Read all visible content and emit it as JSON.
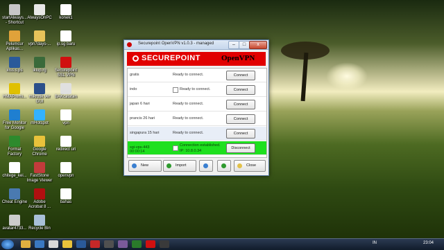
{
  "desktop": {
    "icons": [
      {
        "label": "startAlways... - Shortcut",
        "color": "#c7c7c7"
      },
      {
        "label": "AlwaysOnPC",
        "color": "#e8e8e8"
      },
      {
        "label": "konek1",
        "color": "#ffffff"
      },
      {
        "label": "Pelumcur Aplikas...",
        "color": "#e0a23a"
      },
      {
        "label": "vpn7days-...",
        "color": "#e6c35a"
      },
      {
        "label": "ip.sg baru",
        "color": "#ffffff"
      },
      {
        "label": "kiss.s.ps",
        "color": "#2a5a9a"
      },
      {
        "label": "ikiup.rg",
        "color": "#3a6a3a"
      },
      {
        "label": "Securepoint SSL VPN",
        "color": "#d01010"
      },
      {
        "label": "HMAPremi...",
        "color": "#e0c000"
      },
      {
        "label": "mikrotik ver GUI",
        "color": "#2b4f8a"
      },
      {
        "label": "BAKcatatan",
        "color": "#e0e0e0"
      },
      {
        "label": "Free Monitor for Google",
        "color": "#1f7fd0"
      },
      {
        "label": "mHotspot",
        "color": "#33b2ff"
      },
      {
        "label": "vpn",
        "color": "#ffffff"
      },
      {
        "label": "Format Factory",
        "color": "#2d8a2d"
      },
      {
        "label": "Google Chrome",
        "color": "#e9c23b"
      },
      {
        "label": "redirect uri",
        "color": "#ffffff"
      },
      {
        "label": "chitege_kei...",
        "color": "#ffffff"
      },
      {
        "label": "FastStone Image Viewer",
        "color": "#c23b3b"
      },
      {
        "label": "openvpn",
        "color": "#ffffff"
      },
      {
        "label": "Cheat Engine",
        "color": "#4a7ab0"
      },
      {
        "label": "Adobe Acrobat 8 ...",
        "color": "#b01010"
      },
      {
        "label": "bahas",
        "color": "#ffffff"
      },
      {
        "label": "avatar4733...",
        "color": "#cccccc"
      },
      {
        "label": "Recycle Bin",
        "color": "#a8c0d8"
      }
    ]
  },
  "window": {
    "title": "Securepoint OpenVPN v1.0.3 - managed",
    "controls": {
      "minimize": "–",
      "maximize": "□",
      "close": "x"
    },
    "banner": {
      "brand": "SECUREPOINT",
      "product": "OpenVPN"
    },
    "connections": [
      {
        "name": "gratis",
        "status": "Ready to connect.",
        "button": "Connect",
        "state": "idle"
      },
      {
        "name": "indo",
        "status": "Ready to connect.",
        "button": "Connect",
        "state": "idle"
      },
      {
        "name": "japan 6 hari",
        "status": "Ready to connect.",
        "button": "Connect",
        "state": "idle"
      },
      {
        "name": "prancis 26 hari",
        "status": "Ready to connect.",
        "button": "Connect",
        "state": "idle"
      },
      {
        "name": "singapura 15 hari",
        "status": "Ready to connect.",
        "button": "Connect",
        "state": "selected"
      },
      {
        "name": "sgi-vps-443",
        "name2": "00:00:14",
        "status": "Connection established.",
        "status2": "IP: 10.8.0.34",
        "button": "Disconnect",
        "state": "active"
      }
    ],
    "toolbar": {
      "new": "New",
      "import": "Import",
      "close": "Close"
    }
  },
  "taskbar": {
    "tray_lang": "IN",
    "clock": "23:04"
  },
  "colors": {
    "banner_red": "#e10000",
    "connected_green": "#1ee01e"
  }
}
